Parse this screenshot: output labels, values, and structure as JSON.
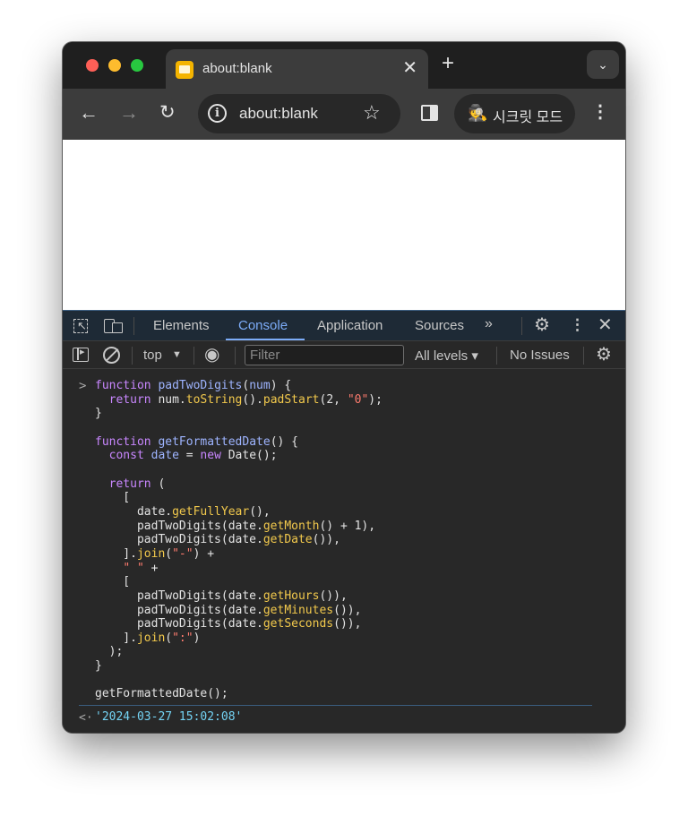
{
  "window": {
    "tab_title": "about:blank",
    "tab_close_glyph": "✕",
    "new_tab_glyph": "+",
    "tab_search_glyph": "⌄"
  },
  "toolbar": {
    "back_glyph": "←",
    "forward_glyph": "→",
    "reload_glyph": "↻",
    "info_glyph": "i",
    "url": "about:blank",
    "star_glyph": "☆",
    "incognito_label": "시크릿 모드",
    "menu_glyph": "⋮"
  },
  "devtools": {
    "tabs": [
      {
        "label": "Elements"
      },
      {
        "label": "Console",
        "active": true
      },
      {
        "label": "Application"
      },
      {
        "label": "Sources"
      }
    ],
    "more_glyph": "»",
    "gear_glyph": "⚙",
    "dots_glyph": "⋮",
    "close_glyph": "✕"
  },
  "console_toolbar": {
    "context": "top",
    "context_arrow": "▼",
    "eye_glyph": "◉",
    "filter_placeholder": "Filter",
    "levels": "All levels ▾",
    "issues": "No Issues",
    "gear_glyph": "⚙"
  },
  "console": {
    "input_prompt": ">",
    "code_lines": [
      "function padTwoDigits(num) {",
      "  return num.toString().padStart(2, \"0\");",
      "}",
      "",
      "function getFormattedDate() {",
      "  const date = new Date();",
      "",
      "  return (",
      "    [",
      "      date.getFullYear(),",
      "      padTwoDigits(date.getMonth() + 1),",
      "      padTwoDigits(date.getDate()),",
      "    ].join(\"-\") +",
      "    \" \" +",
      "    [",
      "      padTwoDigits(date.getHours()),",
      "      padTwoDigits(date.getMinutes()),",
      "      padTwoDigits(date.getSeconds()),",
      "    ].join(\":\")",
      "  );",
      "}",
      "",
      "getFormattedDate();"
    ],
    "output_prompt": "<·",
    "result": "'2024-03-27 15:02:08'"
  },
  "colors": {
    "keyword": "#c987ff",
    "function": "#9eb4ff",
    "method": "#f2c94c",
    "string": "#fd7b6e",
    "result": "#74d4f5",
    "active_tab": "#7cacf8"
  }
}
